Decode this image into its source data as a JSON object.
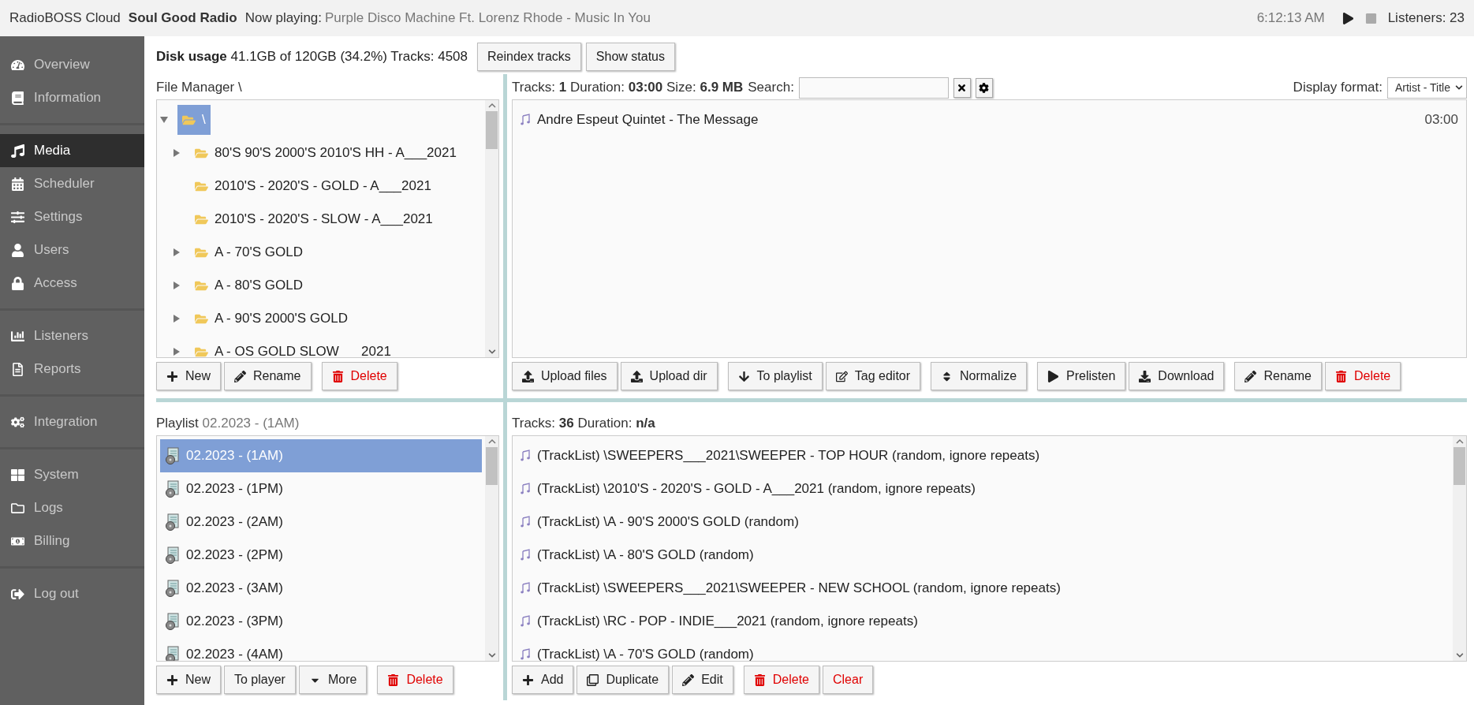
{
  "header": {
    "app": "RadioBOSS Cloud",
    "station": "Soul Good Radio",
    "now_playing_label": "Now playing:",
    "now_playing": "Purple Disco Machine Ft. Lorenz Rhode - Music In You",
    "time": "6:12:13 AM",
    "listeners": "Listeners: 23"
  },
  "sidebar": {
    "groups": [
      [
        {
          "label": "Overview",
          "selected": false
        },
        {
          "label": "Information",
          "selected": false
        }
      ],
      [
        {
          "label": "Media",
          "selected": true
        },
        {
          "label": "Scheduler",
          "selected": false
        },
        {
          "label": "Settings",
          "selected": false
        },
        {
          "label": "Users",
          "selected": false
        },
        {
          "label": "Access",
          "selected": false
        }
      ],
      [
        {
          "label": "Listeners",
          "selected": false
        },
        {
          "label": "Reports",
          "selected": false
        }
      ],
      [
        {
          "label": "Integration",
          "selected": false
        }
      ],
      [
        {
          "label": "System",
          "selected": false
        },
        {
          "label": "Logs",
          "selected": false
        },
        {
          "label": "Billing",
          "selected": false
        }
      ],
      [
        {
          "label": "Log out",
          "selected": false
        }
      ]
    ]
  },
  "disk": {
    "label": "Disk usage",
    "value": "41.1GB of 120GB (34.2%) Tracks: 4508",
    "buttons": [
      "Reindex tracks",
      "Show status"
    ]
  },
  "file_manager": {
    "title": "File Manager \\",
    "tree": [
      {
        "label": "\\",
        "expanded": true,
        "selected": true,
        "children": [
          {
            "label": "80'S 90'S 2000'S 2010'S HH - A___2021",
            "expandable": true
          },
          {
            "label": "2010'S - 2020'S - GOLD - A___2021",
            "expandable": false
          },
          {
            "label": "2010'S - 2020'S - SLOW - A___2021",
            "expandable": false
          },
          {
            "label": "A - 70'S GOLD",
            "expandable": true
          },
          {
            "label": "A - 80'S GOLD",
            "expandable": true
          },
          {
            "label": "A - 90'S 2000'S GOLD",
            "expandable": true
          },
          {
            "label": "A - OS GOLD SLOW___2021",
            "expandable": true
          }
        ]
      }
    ],
    "buttons": [
      [
        {
          "label": "New",
          "kind": "new"
        },
        {
          "label": "Rename",
          "kind": "rename"
        }
      ],
      [
        {
          "label": "Delete",
          "kind": "delete"
        }
      ]
    ]
  },
  "tracks": {
    "stats": "Tracks: **1** Duration: **03:00** Size: **6.9 MB**",
    "search_label": "Search:",
    "display_format_label": "Display format:",
    "display_format": "Artist - Title",
    "items": [
      {
        "title": "Andre Espeut Quintet - The Message",
        "duration": "03:00"
      }
    ],
    "buttons": [
      [
        {
          "label": "Upload files",
          "kind": "upload"
        },
        {
          "label": "Upload dir",
          "kind": "upload"
        }
      ],
      [
        {
          "label": "To playlist",
          "kind": "to-playlist"
        },
        {
          "label": "Tag editor",
          "kind": "tag"
        }
      ],
      [
        {
          "label": "Normalize",
          "kind": "normalize"
        }
      ],
      [
        {
          "label": "Prelisten",
          "kind": "play"
        },
        {
          "label": "Download",
          "kind": "download"
        }
      ],
      [
        {
          "label": "Rename",
          "kind": "rename"
        },
        {
          "label": "Delete",
          "kind": "delete"
        }
      ]
    ]
  },
  "playlist": {
    "title_label": "Playlist",
    "title_value": "02.2023 - (1AM)",
    "items": [
      {
        "label": "02.2023 - (1AM)",
        "selected": true
      },
      {
        "label": "02.2023 - (1PM)",
        "selected": false
      },
      {
        "label": "02.2023 - (2AM)",
        "selected": false
      },
      {
        "label": "02.2023 - (2PM)",
        "selected": false
      },
      {
        "label": "02.2023 - (3AM)",
        "selected": false
      },
      {
        "label": "02.2023 - (3PM)",
        "selected": false
      },
      {
        "label": "02.2023 - (4AM)",
        "selected": false
      }
    ],
    "buttons": [
      [
        {
          "label": "New",
          "kind": "new"
        },
        {
          "label": "To player",
          "kind": "plain"
        },
        {
          "label": "More",
          "kind": "more"
        }
      ],
      [
        {
          "label": "Delete",
          "kind": "delete"
        }
      ]
    ]
  },
  "playlist_tracks": {
    "stats": "Tracks: **36** Duration: **n/a**",
    "items": [
      "(TrackList) \\SWEEPERS___2021\\SWEEPER - TOP HOUR (random, ignore repeats)",
      "(TrackList) \\2010'S - 2020'S - GOLD - A___2021 (random, ignore repeats)",
      "(TrackList) \\A - 90'S 2000'S GOLD (random)",
      "(TrackList) \\A - 80'S GOLD (random)",
      "(TrackList) \\SWEEPERS___2021\\SWEEPER - NEW SCHOOL (random, ignore repeats)",
      "(TrackList) \\RC - POP - INDIE___2021 (random, ignore repeats)",
      "(TrackList) \\A - 70'S GOLD (random)"
    ],
    "buttons": [
      [
        {
          "label": "Add",
          "kind": "new"
        },
        {
          "label": "Duplicate",
          "kind": "duplicate"
        },
        {
          "label": "Edit",
          "kind": "rename"
        }
      ],
      [
        {
          "label": "Delete",
          "kind": "delete"
        },
        {
          "label": "Clear",
          "kind": "clear"
        }
      ]
    ]
  }
}
